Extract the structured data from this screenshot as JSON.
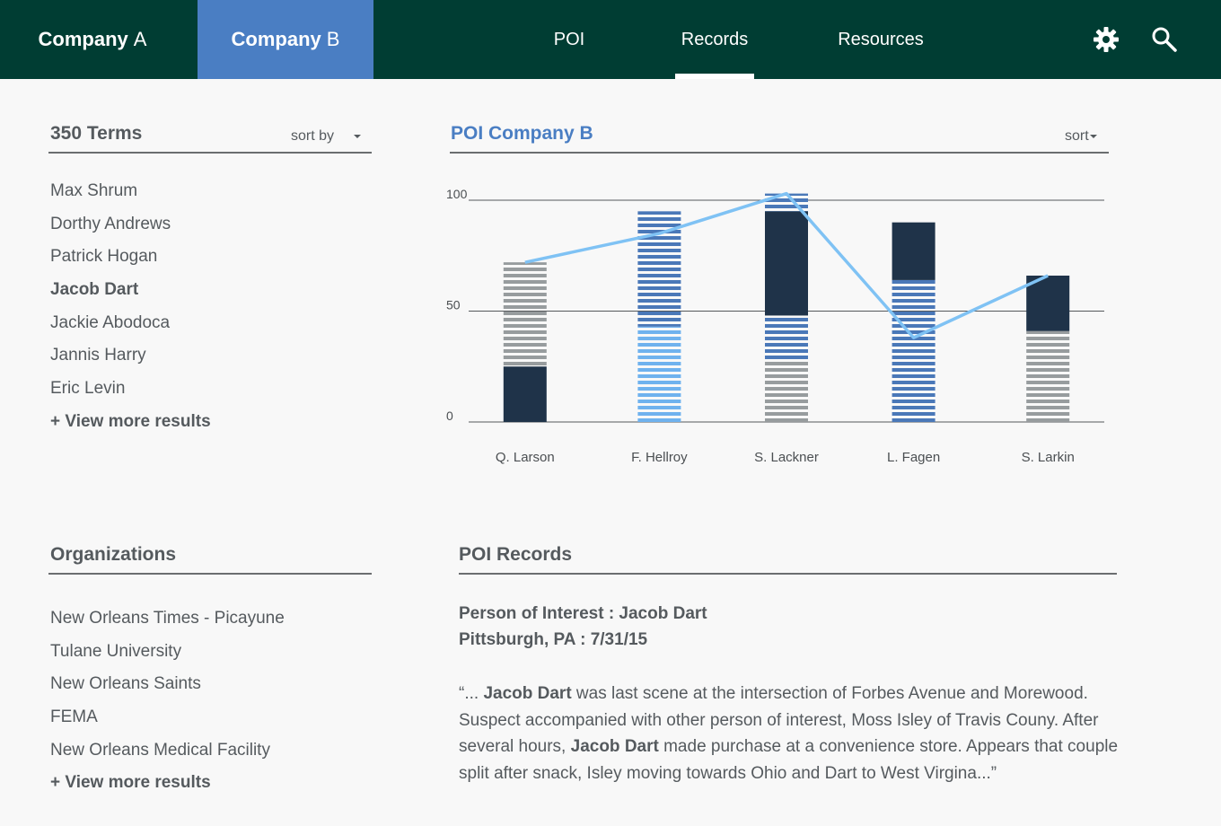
{
  "header": {
    "company_a": {
      "name": "Company",
      "letter": "A"
    },
    "company_b": {
      "name": "Company",
      "letter": "B"
    },
    "nav": [
      "POI",
      "Records",
      "Resources"
    ]
  },
  "terms": {
    "title": "350 Terms",
    "sort_label": "sort by",
    "items": [
      "Max Shrum",
      "Dorthy Andrews",
      "Patrick Hogan",
      "Jacob Dart",
      "Jackie Abodoca",
      "Jannis Harry",
      "Eric Levin"
    ],
    "selected": "Jacob Dart",
    "more": "+ View more results"
  },
  "organizations": {
    "title": "Organizations",
    "items": [
      "New Orleans Times - Picayune",
      "Tulane University",
      "New Orleans Saints",
      "FEMA",
      "New Orleans Medical Facility"
    ],
    "more": "+ View more results"
  },
  "poi_panel": {
    "title": "POI Company B",
    "sort_label": "sort"
  },
  "chart_data": {
    "type": "bar",
    "stacked": true,
    "categories": [
      "Q. Larson",
      "F. Hellroy",
      "S. Lackner",
      "L. Fagen",
      "S. Larkin"
    ],
    "ytick_labels": [
      "100",
      "50",
      "0"
    ],
    "ylim": [
      0,
      100
    ],
    "grid": true,
    "colors": {
      "dark": "#1f3349",
      "blue": "#4a78b8",
      "light_blue": "#6fb2ee",
      "gray": "#979c9e",
      "line": "#7fc2f4"
    },
    "series": [
      {
        "color_key": "dark",
        "values": [
          25,
          0,
          47,
          26,
          25
        ]
      },
      {
        "color_key": "gray",
        "values": [
          47,
          0,
          28,
          0,
          41
        ]
      },
      {
        "color_key": "blue",
        "values": [
          0,
          52,
          20,
          64,
          0
        ]
      },
      {
        "color_key": "light_blue",
        "values": [
          0,
          43,
          0,
          0,
          0
        ]
      },
      {
        "color_key": "blue",
        "values": [
          0,
          0,
          8,
          0,
          0
        ]
      }
    ],
    "stack_order": [
      [
        "dark",
        "gray"
      ],
      [
        "light_blue",
        "blue"
      ],
      [
        "gray",
        "blue",
        "dark",
        "blue"
      ],
      [
        "blue",
        "dark"
      ],
      [
        "gray",
        "dark"
      ]
    ],
    "line_values": [
      72,
      85,
      103,
      38,
      66
    ]
  },
  "records": {
    "title": "POI Records",
    "poi_line": "Person of Interest :  Jacob Dart",
    "place_line": "Pittsburgh, PA : 7/31/15",
    "quote_open": "“... ",
    "name": "Jacob Dart",
    "seg1": " was last scene at the intersection of Forbes Avenue and Morewood. Suspect accompanied with other person of interest, Moss Isley of Travis Couny. After several hours, ",
    "seg2": " made purchase at a convenience store. Appears that couple split after snack, Isley moving towards Ohio and Dart to West Virgina...”"
  }
}
